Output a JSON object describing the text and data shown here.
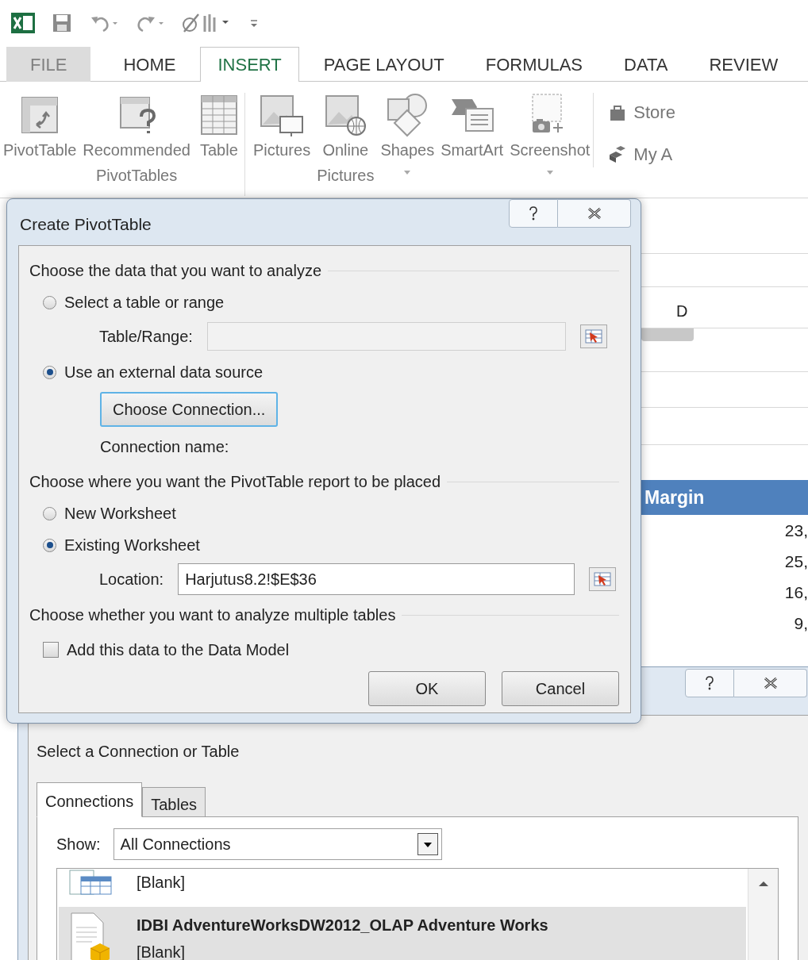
{
  "ribbon_tabs": [
    {
      "label": "FILE",
      "selected": false,
      "kind": "file"
    },
    {
      "label": "HOME",
      "selected": false,
      "kind": "tab"
    },
    {
      "label": "INSERT",
      "selected": true,
      "kind": "tab"
    },
    {
      "label": "PAGE LAYOUT",
      "selected": false,
      "kind": "tab"
    },
    {
      "label": "FORMULAS",
      "selected": false,
      "kind": "tab"
    },
    {
      "label": "DATA",
      "selected": false,
      "kind": "tab"
    },
    {
      "label": "REVIEW",
      "selected": false,
      "kind": "tab"
    }
  ],
  "ribbon_groups": [
    [
      {
        "label": "PivotTable",
        "kind": "pivot",
        "has_menu": false
      },
      {
        "label": "Recommended\nPivotTables",
        "kind": "recommended",
        "has_menu": false
      },
      {
        "label": "Table",
        "kind": "table",
        "has_menu": false
      }
    ],
    [
      {
        "label": "Pictures",
        "kind": "pictures",
        "has_menu": false
      },
      {
        "label": "Online\nPictures",
        "kind": "online",
        "has_menu": false
      },
      {
        "label": "Shapes",
        "kind": "shapes",
        "has_menu": true
      },
      {
        "label": "SmartArt",
        "kind": "smartart",
        "has_menu": false
      },
      {
        "label": "Screenshot",
        "kind": "screenshot",
        "has_menu": true
      }
    ]
  ],
  "addins": [
    {
      "label": "Store",
      "kind": "store"
    },
    {
      "label": "My A",
      "kind": "apps"
    }
  ],
  "sheet": {
    "column_header": "D",
    "margin_header": "Margin",
    "values": [
      "23,",
      "25,",
      "16,",
      "9,"
    ]
  },
  "create_dialog": {
    "title": "Create PivotTable",
    "section_data": "Choose the data that you want to analyze",
    "source_options": [
      {
        "label": "Select a table or range",
        "selected": false
      },
      {
        "label": "Use an external data source",
        "selected": true
      }
    ],
    "table_range": {
      "label": "Table/Range:",
      "disabled": true
    },
    "choose_connection": "Choose Connection...",
    "connection_name": "Connection name:",
    "section_place": "Choose where you want the PivotTable report to be placed",
    "placement_options": [
      {
        "label": "New Worksheet",
        "selected": false
      },
      {
        "label": "Existing Worksheet",
        "selected": true
      }
    ],
    "location": {
      "label": "Location:",
      "value": "Harjutus8.2!$E$36"
    },
    "section_multi": "Choose whether you want to analyze multiple tables",
    "data_model": {
      "label": "Add this data to the Data Model",
      "checked": false
    },
    "buttons": [
      "OK",
      "Cancel"
    ]
  },
  "connection_dialog": {
    "heading": "Select a Connection or Table",
    "tabs": [
      {
        "label": "Connections",
        "selected": true
      },
      {
        "label": "Tables",
        "selected": false
      }
    ],
    "show": {
      "label": "Show:",
      "value": "All Connections"
    },
    "items": [
      {
        "kind": "table",
        "title": "[Blank]",
        "selected": false
      },
      {
        "kind": "cube",
        "title": "IDBI AdventureWorksDW2012_OLAP Adventure Works",
        "subtitle": "[Blank]",
        "selected": true
      }
    ]
  }
}
